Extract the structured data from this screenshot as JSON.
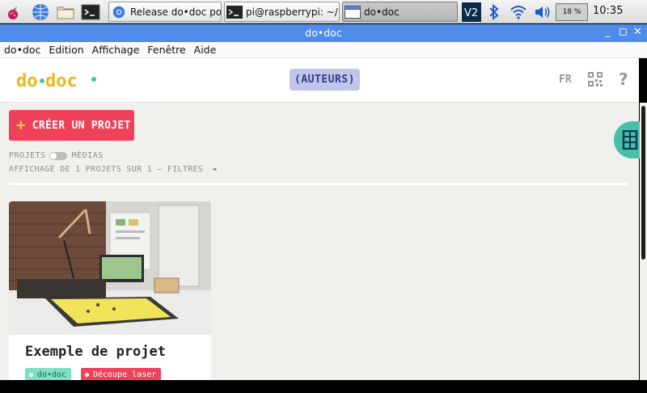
{
  "taskbar": {
    "tasks": [
      {
        "label": "Release do•doc po..."
      },
      {
        "label": "pi@raspberrypi: ~/..."
      },
      {
        "label": "do•doc"
      }
    ],
    "battery": "18 %",
    "clock": "10:35"
  },
  "window": {
    "title": "do•doc",
    "controls": [
      "_",
      "◻",
      "✕"
    ]
  },
  "menu": {
    "items": [
      "do•doc",
      "Edition",
      "Affichage",
      "Fenêtre",
      "Aide"
    ]
  },
  "header": {
    "logo_text": "do•doc",
    "authors_label": "(AUTEURS)",
    "lang": "FR",
    "help": "?"
  },
  "main": {
    "create_button": {
      "plus": "+",
      "label": "CRÉER UN PROJET"
    },
    "mode": {
      "left": "PROJETS",
      "right": "MÉDIAS"
    },
    "filter_text": "AFFICHAGE DE 1 PROJETS SUR 1 — FILTRES",
    "filter_arrow": "◄",
    "project": {
      "title": "Exemple de projet",
      "tags": [
        "do•doc",
        "Découpe laser"
      ]
    }
  },
  "colors": {
    "accent_red": "#f0415a",
    "accent_teal": "#47c0a5",
    "authors_bg": "#c0c6e8",
    "titlebar_blue": "#4f8be9"
  }
}
